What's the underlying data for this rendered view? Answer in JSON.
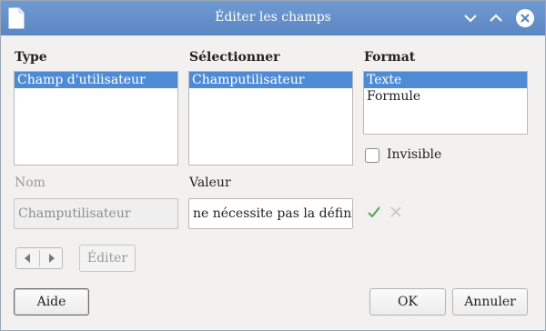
{
  "window": {
    "title": "Éditer les champs"
  },
  "type_section": {
    "label": "Type",
    "items": [
      {
        "label": "Champ d'utilisateur",
        "selected": true
      }
    ]
  },
  "select_section": {
    "label": "Sélectionner",
    "items": [
      {
        "label": "Champutilisateur",
        "selected": true
      }
    ]
  },
  "format_section": {
    "label": "Format",
    "items": [
      {
        "label": "Texte",
        "selected": true
      },
      {
        "label": "Formule",
        "selected": false
      }
    ]
  },
  "invisible": {
    "label": "Invisible",
    "checked": false
  },
  "name_field": {
    "label": "Nom",
    "value": "Champutilisateur",
    "enabled": false
  },
  "value_field": {
    "label": "Valeur",
    "value": "ne nécessite pas la définitio"
  },
  "buttons": {
    "edit": "Éditer",
    "help": "Aide",
    "ok": "OK",
    "cancel": "Annuler"
  },
  "colors": {
    "titlebar": "#5b86c2",
    "selection": "#4f8bd4",
    "apply_check": "#5aa05a",
    "close_button": "#ffffff"
  },
  "icons": {
    "app": "document-icon",
    "minimize": "chevron-down-icon",
    "maximize": "chevron-up-icon",
    "close": "close-icon",
    "apply": "checkmark-icon",
    "discard": "x-icon",
    "prev": "arrow-left-icon",
    "next": "arrow-right-icon"
  }
}
